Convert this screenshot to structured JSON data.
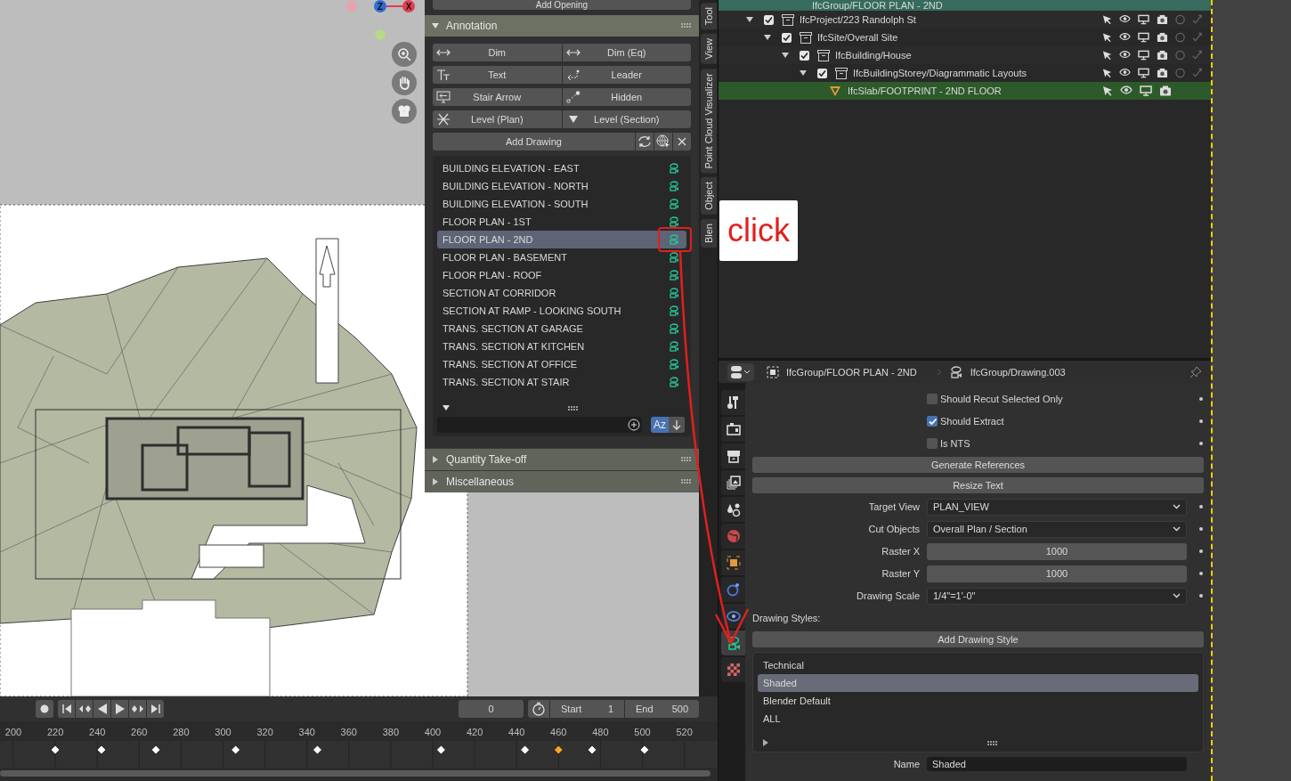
{
  "viewport": {
    "gizmo": [
      {
        "label": "Z",
        "color": "#2c6ed6"
      },
      {
        "label": "X",
        "color": "#e53d51"
      }
    ]
  },
  "sidebar": {
    "top_button": "Add Opening",
    "annotation": {
      "title": "Annotation",
      "expanded": true,
      "tools": [
        {
          "label": "Dim",
          "kind": "dim"
        },
        {
          "label": "Dim (Eq)",
          "kind": "dim"
        },
        {
          "label": "Text",
          "kind": "text"
        },
        {
          "label": "Leader",
          "kind": "leader"
        },
        {
          "label": "Stair Arrow",
          "kind": "stair"
        },
        {
          "label": "Hidden",
          "kind": "hidden"
        },
        {
          "label": "Level (Plan)",
          "kind": "level-plan"
        },
        {
          "label": "Level (Section)",
          "kind": "level-section"
        }
      ],
      "add_drawing": "Add Drawing",
      "drawings": [
        {
          "name": "BUILDING ELEVATION - EAST",
          "selected": false
        },
        {
          "name": "BUILDING ELEVATION - NORTH",
          "selected": false
        },
        {
          "name": "BUILDING ELEVATION - SOUTH",
          "selected": false
        },
        {
          "name": "FLOOR PLAN - 1ST",
          "selected": false
        },
        {
          "name": "FLOOR PLAN - 2ND",
          "selected": true
        },
        {
          "name": "FLOOR PLAN - BASEMENT",
          "selected": false
        },
        {
          "name": "FLOOR PLAN - ROOF",
          "selected": false
        },
        {
          "name": "SECTION AT CORRIDOR",
          "selected": false
        },
        {
          "name": "SECTION AT RAMP - LOOKING SOUTH",
          "selected": false
        },
        {
          "name": "TRANS. SECTION AT GARAGE",
          "selected": false
        },
        {
          "name": "TRANS. SECTION AT KITCHEN",
          "selected": false
        },
        {
          "name": "TRANS. SECTION AT OFFICE",
          "selected": false
        },
        {
          "name": "TRANS. SECTION AT STAIR",
          "selected": false
        }
      ],
      "sort_toggle": {
        "label": "Az",
        "on": true
      }
    },
    "panels": [
      {
        "title": "Quantity Take-off",
        "expanded": false
      },
      {
        "title": "Miscellaneous",
        "expanded": false
      }
    ]
  },
  "tabs": [
    {
      "label": "Tool"
    },
    {
      "label": "View"
    },
    {
      "label": "Point Cloud Visualizer"
    },
    {
      "label": "Object"
    },
    {
      "label": "Blen"
    }
  ],
  "callout": {
    "text": "click"
  },
  "outliner": {
    "top_row": {
      "label": "IfcGroup/FLOOR PLAN - 2ND",
      "selected": true
    },
    "tree": [
      {
        "label": "IfcProject/223 Randolph St",
        "kind": "collection",
        "checked": true,
        "expanded": true,
        "selected": false,
        "children": [
          {
            "label": "IfcSite/Overall Site",
            "kind": "collection",
            "checked": true,
            "expanded": true,
            "selected": false,
            "children": [
              {
                "label": "IfcBuilding/House",
                "kind": "collection",
                "checked": true,
                "expanded": true,
                "selected": false,
                "children": [
                  {
                    "label": "IfcBuildingStorey/Diagrammatic Layouts",
                    "kind": "collection",
                    "checked": true,
                    "expanded": true,
                    "selected": false,
                    "children": [
                      {
                        "label": "IfcSlab/FOOTPRINT - 2ND FLOOR",
                        "kind": "mesh",
                        "selected": true
                      }
                    ]
                  }
                ]
              }
            ]
          }
        ]
      }
    ]
  },
  "properties": {
    "breadcrumbs": [
      "IfcGroup/FLOOR PLAN - 2ND",
      "IfcGroup/Drawing.003"
    ],
    "tabs": [
      {
        "kind": "tool",
        "selected": false
      },
      {
        "kind": "render",
        "selected": false
      },
      {
        "kind": "output",
        "selected": false
      },
      {
        "kind": "view-layer",
        "selected": false
      },
      {
        "kind": "scene",
        "selected": false
      },
      {
        "kind": "world",
        "selected": false
      },
      {
        "kind": "object",
        "selected": false
      },
      {
        "kind": "physics",
        "selected": false
      },
      {
        "kind": "constraint",
        "selected": false
      },
      {
        "kind": "drawing",
        "selected": true
      },
      {
        "kind": "texture",
        "selected": false
      }
    ],
    "checkboxes": [
      {
        "label": "Should Recut Selected Only",
        "checked": false
      },
      {
        "label": "Should Extract",
        "checked": true
      },
      {
        "label": "Is NTS",
        "checked": false
      }
    ],
    "buttons": [
      "Generate References",
      "Resize Text"
    ],
    "fields": [
      {
        "label": "Target View",
        "value": "PLAN_VIEW",
        "kind": "dropdown"
      },
      {
        "label": "Cut Objects",
        "value": "Overall Plan / Section",
        "kind": "dropdown"
      },
      {
        "label": "Raster X",
        "value": "1000",
        "kind": "number"
      },
      {
        "label": "Raster Y",
        "value": "1000",
        "kind": "number"
      },
      {
        "label": "Drawing Scale",
        "value": "1/4\"=1'-0\"",
        "kind": "dropdown"
      }
    ],
    "styles_label": "Drawing Styles:",
    "add_style": "Add Drawing Style",
    "styles": [
      {
        "name": "Technical",
        "selected": false
      },
      {
        "name": "Shaded",
        "selected": true
      },
      {
        "name": "Blender Default",
        "selected": false
      },
      {
        "name": "ALL",
        "selected": false
      }
    ],
    "name_field": {
      "label": "Name",
      "value": "Shaded"
    }
  },
  "timeline": {
    "frame": "0",
    "start": {
      "label": "Start",
      "value": "1"
    },
    "end": {
      "label": "End",
      "value": "500"
    },
    "ruler": [
      "200",
      "220",
      "240",
      "260",
      "280",
      "300",
      "320",
      "340",
      "360",
      "380",
      "400",
      "420",
      "440",
      "460",
      "480",
      "500",
      "520"
    ]
  }
}
